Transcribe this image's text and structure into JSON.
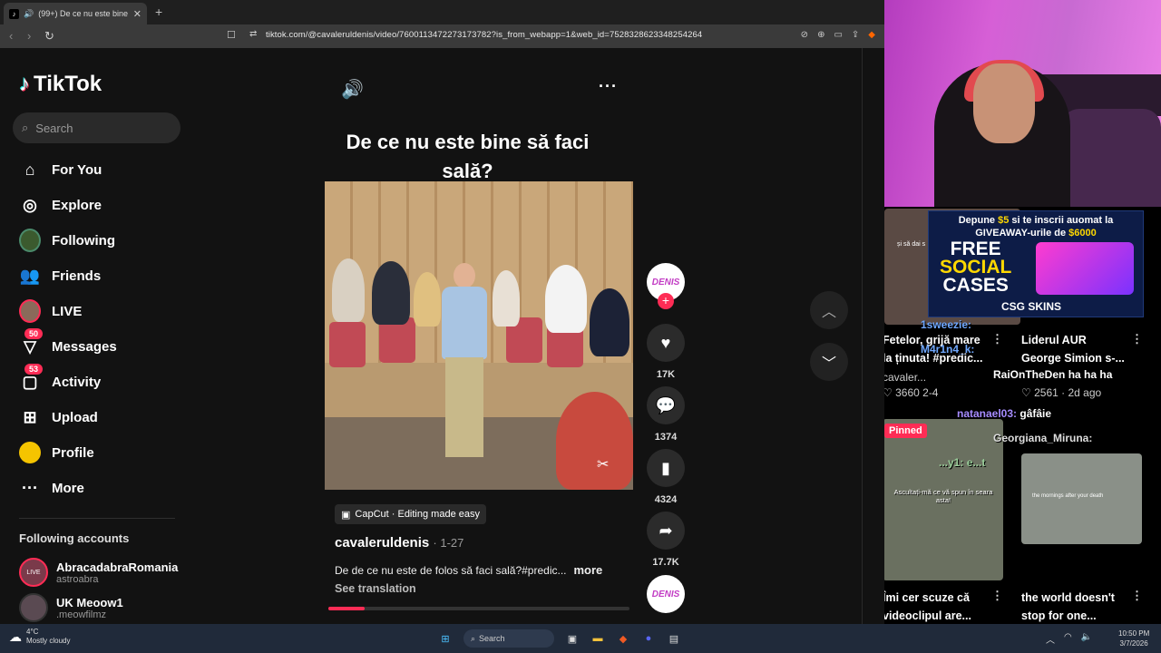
{
  "browser": {
    "tab_title": "(99+) De ce nu este bine să fa",
    "url": "tiktok.com/@cavaleruldenis/video/7600113472273173782?is_from_webapp=1&web_id=7528328623348254264"
  },
  "sidebar": {
    "logo": "TikTok",
    "search_placeholder": "Search",
    "items": [
      {
        "label": "For You",
        "icon": "home-icon"
      },
      {
        "label": "Explore",
        "icon": "compass-icon"
      },
      {
        "label": "Following",
        "icon": "following-avatar-icon"
      },
      {
        "label": "Friends",
        "icon": "friends-icon"
      },
      {
        "label": "LIVE",
        "icon": "live-avatar-icon"
      },
      {
        "label": "Messages",
        "icon": "messages-icon",
        "badge": "50"
      },
      {
        "label": "Activity",
        "icon": "activity-icon",
        "badge": "53"
      },
      {
        "label": "Upload",
        "icon": "upload-icon"
      },
      {
        "label": "Profile",
        "icon": "profile-avatar-icon"
      },
      {
        "label": "More",
        "icon": "more-icon"
      }
    ],
    "following_title": "Following accounts",
    "accounts": [
      {
        "name": "AbracadabraRomania",
        "handle": "astroabra",
        "badge": "LIVE"
      },
      {
        "name": "UK Meoow1",
        "handle": ".meowfilmz"
      }
    ]
  },
  "video": {
    "title": "De ce nu este bine să faci sală?",
    "effect_pill": "CapCut · Editing made easy",
    "author": "cavaleruldenis",
    "date": "· 1-27",
    "description": "De de ce nu este de folos să faci sală?#predic...",
    "more": "more",
    "see_translation": "See translation",
    "progress": 0.12
  },
  "actions": {
    "avatar_text": "DENIS",
    "likes": "17K",
    "comments": "1374",
    "saves": "4324",
    "shares": "17.7K"
  },
  "overlay": {
    "ad": {
      "line1a": "Depune ",
      "line1b": "$5",
      "line1c": " si te inscrii auomat la",
      "line2a": "GIVEAWAY-urile de ",
      "line2b": "$6000",
      "free1": "FREE",
      "free2": "SOCIAL",
      "free3": "CASES",
      "brand": "CSG SKINS"
    },
    "right_videos": [
      {
        "title1": "Fetelor, grijă mare",
        "title2": "la ținuta! #predic...",
        "author": "cavaler...",
        "likes": "3660",
        "date": "2-4"
      },
      {
        "title1": "Liderul AUR",
        "title2": "George Simion s-...",
        "author": "",
        "likes": "2561",
        "date": "2d ago"
      },
      {
        "title1": "Îmi cer scuze că",
        "title2": "videoclipul are...",
        "pinned": "Pinned",
        "caption": "Ascultați-mă ce vă spun în seara asta!"
      },
      {
        "title1": "the world doesn't",
        "title2": "stop for one...",
        "caption": "the mornings after your death"
      }
    ],
    "chat": [
      {
        "user": "1sweezie:",
        "msg": ""
      },
      {
        "user": "M4r1n4_k:",
        "msg": ""
      },
      {
        "user": "RaiOnTheDen",
        "msg": "ha ha ha"
      },
      {
        "user": "natanael03:",
        "msg": "gâfâie"
      },
      {
        "user": "Georgiana_Miruna:",
        "msg": ""
      },
      {
        "user": "...y1:",
        "msg": "e...t"
      }
    ],
    "stream_caption": "și să dai s"
  },
  "taskbar": {
    "temp": "4°C",
    "weather": "Mostly cloudy",
    "search": "Search",
    "time": "10:50 PM",
    "date": "3/7/2026"
  }
}
